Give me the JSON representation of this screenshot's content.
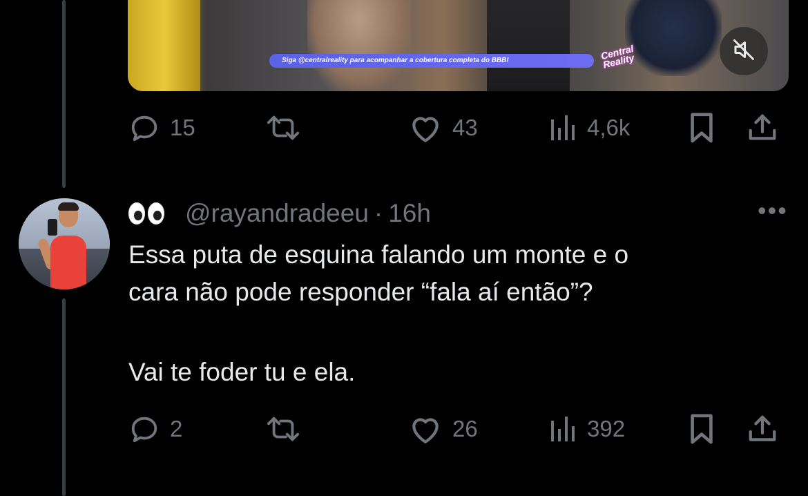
{
  "media": {
    "banner_text": "Siga @centralreality para acompanhar a cobertura completa do BBB!",
    "brand_text": "Central Reality",
    "mute_icon": "speaker-muted-icon"
  },
  "tweet_actions": {
    "replies": "15",
    "likes": "43",
    "views": "4,6k"
  },
  "reply": {
    "display_name_emoji": "👀",
    "handle": "@rayandradeeu",
    "separator": "·",
    "time": "16h",
    "more_label": "•••",
    "lines": [
      "Essa puta de esquina falando um monte e o",
      "cara não pode responder “fala aí então”?",
      "Vai te foder tu e ela."
    ],
    "actions": {
      "replies": "2",
      "likes": "26",
      "views": "392"
    }
  },
  "colors": {
    "background": "#000000",
    "text": "#e7e9ea",
    "muted": "#71767b",
    "thread_line": "#3a3d41"
  }
}
